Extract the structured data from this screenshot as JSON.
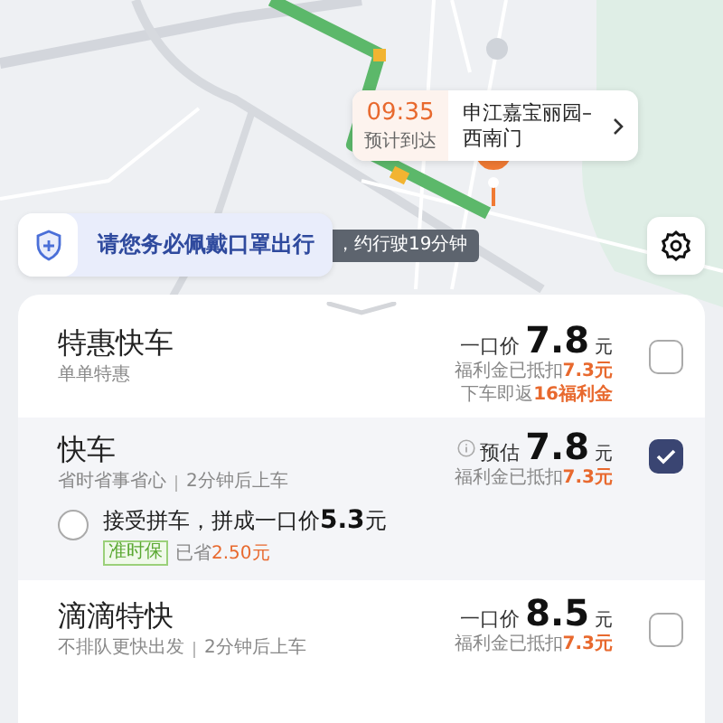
{
  "eta": {
    "time": "09:35",
    "label": "预计到达",
    "destination": "申江嘉宝丽园–西南门"
  },
  "banner": {
    "text": "请您务必佩戴口罩出行",
    "trip_note": "，约行驶19分钟"
  },
  "options": [
    {
      "kind": "single",
      "name": "特惠快车",
      "subtitles": [
        "单单特惠"
      ],
      "price_prefix": "一口价",
      "price_info": false,
      "price": "7.8",
      "unit": "元",
      "selected": false,
      "notes": [
        {
          "label": "福利金已抵扣",
          "amount": "7.3元"
        },
        {
          "label": "下车即返",
          "amount": "16福利金"
        }
      ]
    },
    {
      "kind": "carpool",
      "name": "快车",
      "subtitles": [
        "省时省事省心",
        "2分钟后上车"
      ],
      "price_prefix": "预估",
      "price_info": true,
      "price": "7.8",
      "unit": "元",
      "selected": true,
      "notes": [
        {
          "label": "福利金已抵扣",
          "amount": "7.3元"
        }
      ],
      "carpool": {
        "text": "接受拼车，拼成一口价",
        "price": "5.3",
        "unit": "元",
        "checked": false,
        "tag": "准时保",
        "saved_label": "已省",
        "saved_amount": "2.50元"
      }
    },
    {
      "kind": "single",
      "name": "滴滴特快",
      "subtitles": [
        "不排队更快出发",
        "2分钟后上车"
      ],
      "price_prefix": "一口价",
      "price_info": false,
      "price": "8.5",
      "unit": "元",
      "selected": false,
      "notes": [
        {
          "label": "福利金已抵扣",
          "amount": "7.3元"
        }
      ]
    }
  ]
}
